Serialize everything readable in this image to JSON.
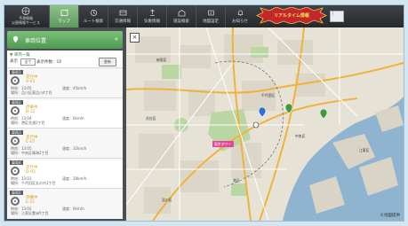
{
  "header": {
    "brand_line1": "予測情報",
    "brand_line2": "災害情報サービス",
    "nav": [
      {
        "label": "マップ",
        "icon": "map-icon"
      },
      {
        "label": "ルート検索",
        "icon": "route-icon"
      },
      {
        "label": "交通情報",
        "icon": "traffic-icon"
      },
      {
        "label": "気象情報",
        "icon": "weather-icon"
      },
      {
        "label": "施設検索",
        "icon": "building-icon"
      },
      {
        "label": "地図設定",
        "icon": "settings-icon"
      },
      {
        "label": "お知らせ",
        "icon": "bell-icon"
      }
    ],
    "badge_text": "リアルタイム情報",
    "user_label": "⋮"
  },
  "sidebar": {
    "title": "車両位置",
    "list_title": "▼ 車両一覧",
    "filter_value": "全て",
    "filter_label": "表示件数：10",
    "update_button": "更新",
    "items": [
      {
        "tag": "車両1",
        "status": "走行中",
        "code": "A-01",
        "line1": "時刻：13:05",
        "line2": "場所：品川区東品川4丁目",
        "line3": "速度：45km/h"
      },
      {
        "tag": "車両2",
        "status": "停車中",
        "code": "B-12",
        "line1": "時刻：13:04",
        "line2": "場所：港区芝浦3丁目",
        "line3": "速度：0km/h"
      },
      {
        "tag": "車両3",
        "status": "走行中",
        "code": "C-07",
        "line1": "時刻：13:05",
        "line2": "場所：中央区晴海2丁目",
        "line3": "速度：32km/h"
      },
      {
        "tag": "車両4",
        "status": "走行中",
        "code": "D-03",
        "line1": "時刻：13:03",
        "line2": "場所：千代田区丸の内1丁目",
        "line3": "速度：28km/h"
      },
      {
        "tag": "車両5",
        "status": "待機中",
        "code": "E-21",
        "line1": "時刻：13:02",
        "line2": "場所：江東区豊洲5丁目",
        "line3": "速度：0km/h"
      }
    ]
  },
  "map": {
    "close_label": "×",
    "zoom_in": "+",
    "zoom_out": "−",
    "labels": [
      {
        "text": "新宿区"
      },
      {
        "text": "千代田区"
      },
      {
        "text": "中央区"
      },
      {
        "text": "港区"
      },
      {
        "text": "江東区"
      },
      {
        "text": "品川区"
      },
      {
        "text": "渋谷区"
      },
      {
        "text": "東京タワー"
      }
    ],
    "copyright": "©地図提供"
  },
  "colors": {
    "accent": "#5d9a5e",
    "sidebar": "#4a4f53",
    "badge": "#c2272d"
  }
}
